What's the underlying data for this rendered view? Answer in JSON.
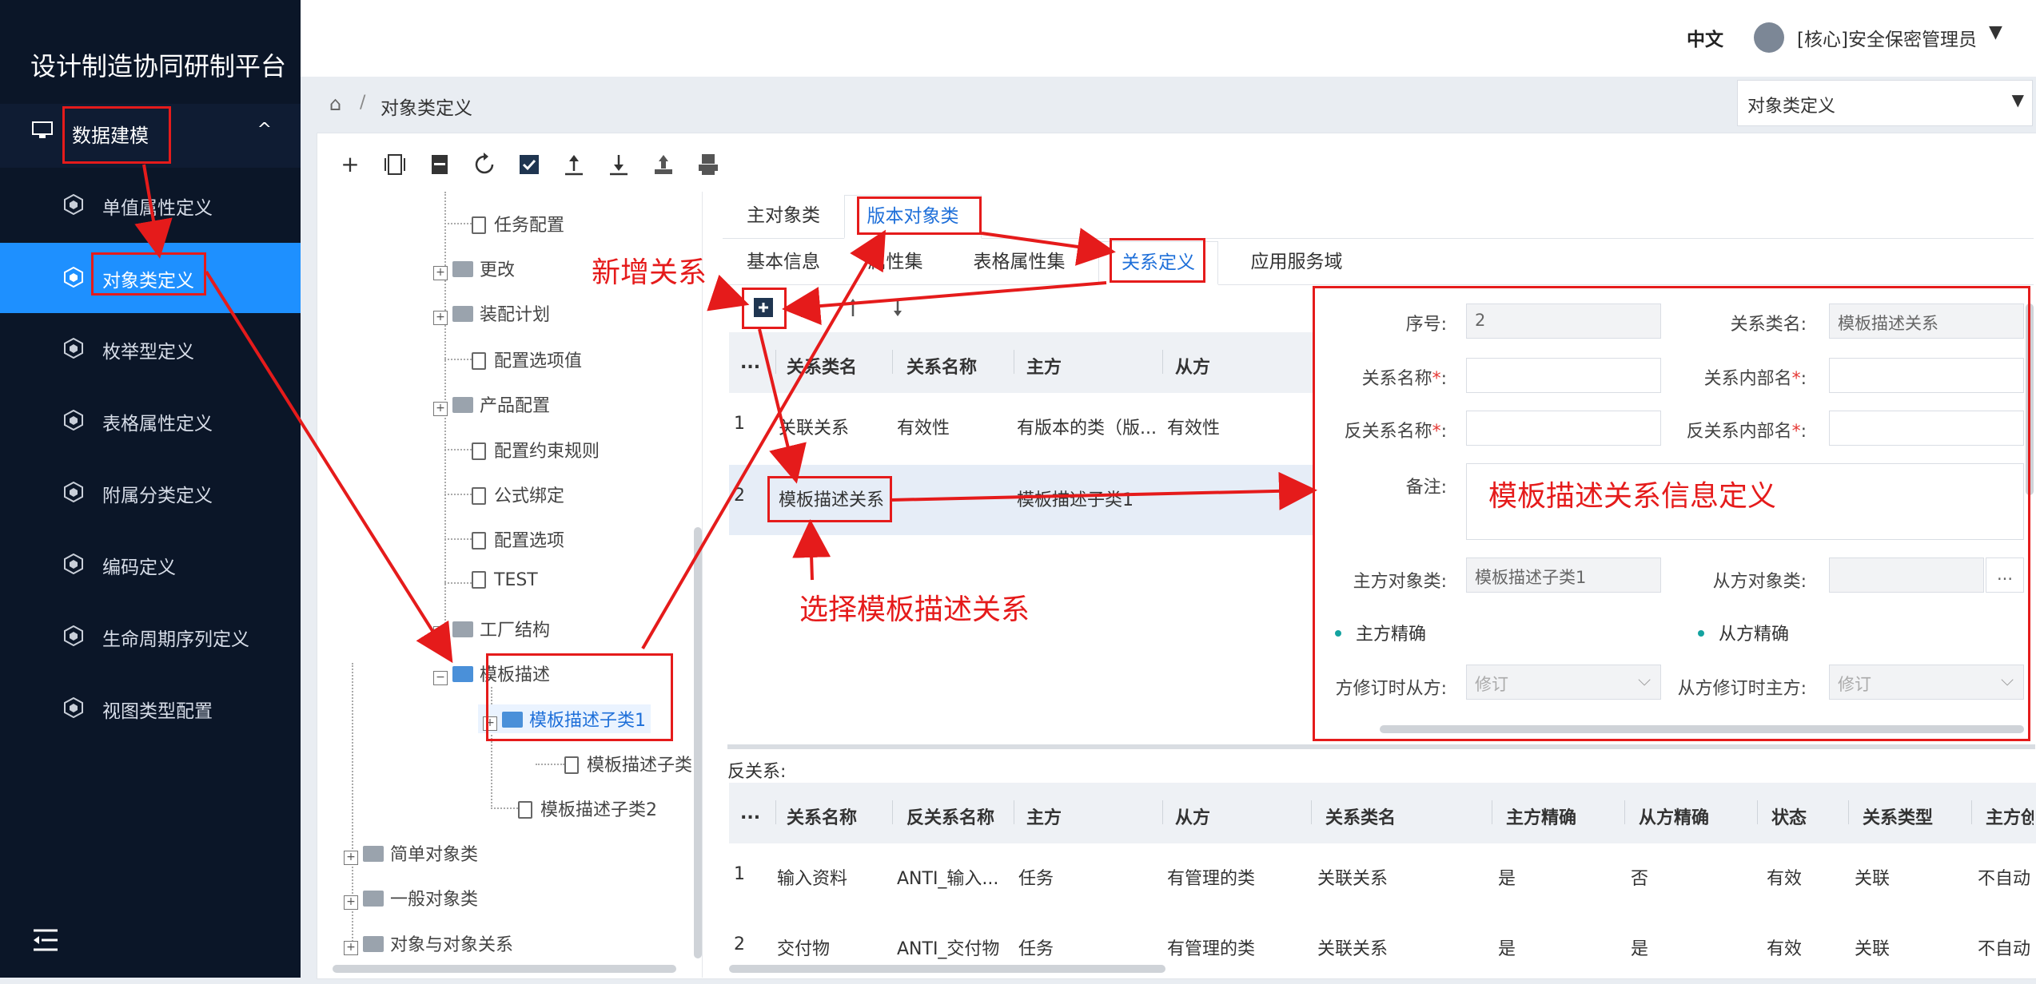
{
  "sidebar": {
    "brand": "设计制造协同研制平台",
    "group_label": "数据建模",
    "group_chevron": "^",
    "items": [
      {
        "label": "单值属性定义"
      },
      {
        "label": "对象类定义"
      },
      {
        "label": "枚举型定义"
      },
      {
        "label": "表格属性定义"
      },
      {
        "label": "附属分类定义"
      },
      {
        "label": "编码定义"
      },
      {
        "label": "生命周期序列定义"
      },
      {
        "label": "视图类型配置"
      }
    ]
  },
  "header": {
    "language": "中文",
    "user": "[核心]安全保密管理员",
    "caret": "▼"
  },
  "breadcrumb": {
    "separator": "/",
    "current": "对象类定义"
  },
  "page_select": {
    "value": "对象类定义",
    "caret": "▼"
  },
  "toolbar": {
    "icons": [
      "plus-icon",
      "copy-icon",
      "save-icon",
      "refresh-icon",
      "check-icon",
      "upload-icon",
      "download-icon",
      "export-icon",
      "print-icon"
    ]
  },
  "tree": {
    "nodes": [
      {
        "label": "任务配置"
      },
      {
        "label": "更改"
      },
      {
        "label": "装配计划"
      },
      {
        "label": "配置选项值"
      },
      {
        "label": "产品配置"
      },
      {
        "label": "配置约束规则"
      },
      {
        "label": "公式绑定"
      },
      {
        "label": "配置选项"
      },
      {
        "label": "TEST"
      },
      {
        "label": "工厂结构"
      },
      {
        "label": "模板描述"
      },
      {
        "label": "模板描述子类1"
      },
      {
        "label": "模板描述子类"
      },
      {
        "label": "模板描述子类2"
      },
      {
        "label": "简单对象类"
      },
      {
        "label": "一般对象类"
      },
      {
        "label": "对象与对象关系"
      }
    ],
    "expand_plus": "+",
    "expand_minus": "−"
  },
  "tabs_top": [
    {
      "label": "主对象类"
    },
    {
      "label": "版本对象类"
    }
  ],
  "tabs_sub": [
    {
      "label": "基本信息"
    },
    {
      "label": "属性集"
    },
    {
      "label": "表格属性集"
    },
    {
      "label": "关系定义"
    },
    {
      "label": "应用服务域"
    }
  ],
  "relation_grid": {
    "headers": [
      "...",
      "关系类名",
      "关系名称",
      "主方",
      "从方"
    ],
    "rows": [
      [
        "1",
        "关联关系",
        "有效性",
        "有版本的类（版...",
        "有效性"
      ],
      [
        "2",
        "模板描述关系",
        "",
        "模板描述子类1",
        ""
      ]
    ]
  },
  "form": {
    "seq_label": "序号:",
    "seq_value": "2",
    "class_label": "关系类名:",
    "class_value": "模板描述关系",
    "name_label": "关系名称",
    "inner_label": "关系内部名",
    "rev_name_label": "反关系名称",
    "rev_inner_label": "反关系内部名",
    "required": "*",
    "colon": ":",
    "remark_label": "备注:",
    "master_label": "主方对象类:",
    "master_value": "模板描述子类1",
    "slave_label": "从方对象类:",
    "ellipsis_btn": "...",
    "master_exact": "主方精确",
    "slave_exact": "从方精确",
    "master_rev_label": "方修订时从方:",
    "master_rev_value": "修订",
    "slave_rev_label": "从方修订时主方:",
    "slave_rev_value": "修订"
  },
  "reverse": {
    "title": "反关系:",
    "headers": [
      "...",
      "关系名称",
      "反关系名称",
      "主方",
      "从方",
      "关系类名",
      "主方精确",
      "从方精确",
      "状态",
      "关系类型",
      "主方创"
    ],
    "rows": [
      [
        "1",
        "输入资料",
        "ANTI_输入...",
        "任务",
        "有管理的类",
        "关联关系",
        "是",
        "否",
        "有效",
        "关联",
        "不自动"
      ],
      [
        "2",
        "交付物",
        "ANTI_交付物",
        "任务",
        "有管理的类",
        "关联关系",
        "是",
        "是",
        "有效",
        "关联",
        "不自动"
      ]
    ]
  },
  "annotations": {
    "add_relation": "新增关系",
    "template_info": "模板描述关系信息定义",
    "select_template": "选择模板描述关系"
  },
  "colors": {
    "accent": "#1e90ff",
    "annotation": "#e51b1b",
    "sidebar": "#0b1628"
  }
}
